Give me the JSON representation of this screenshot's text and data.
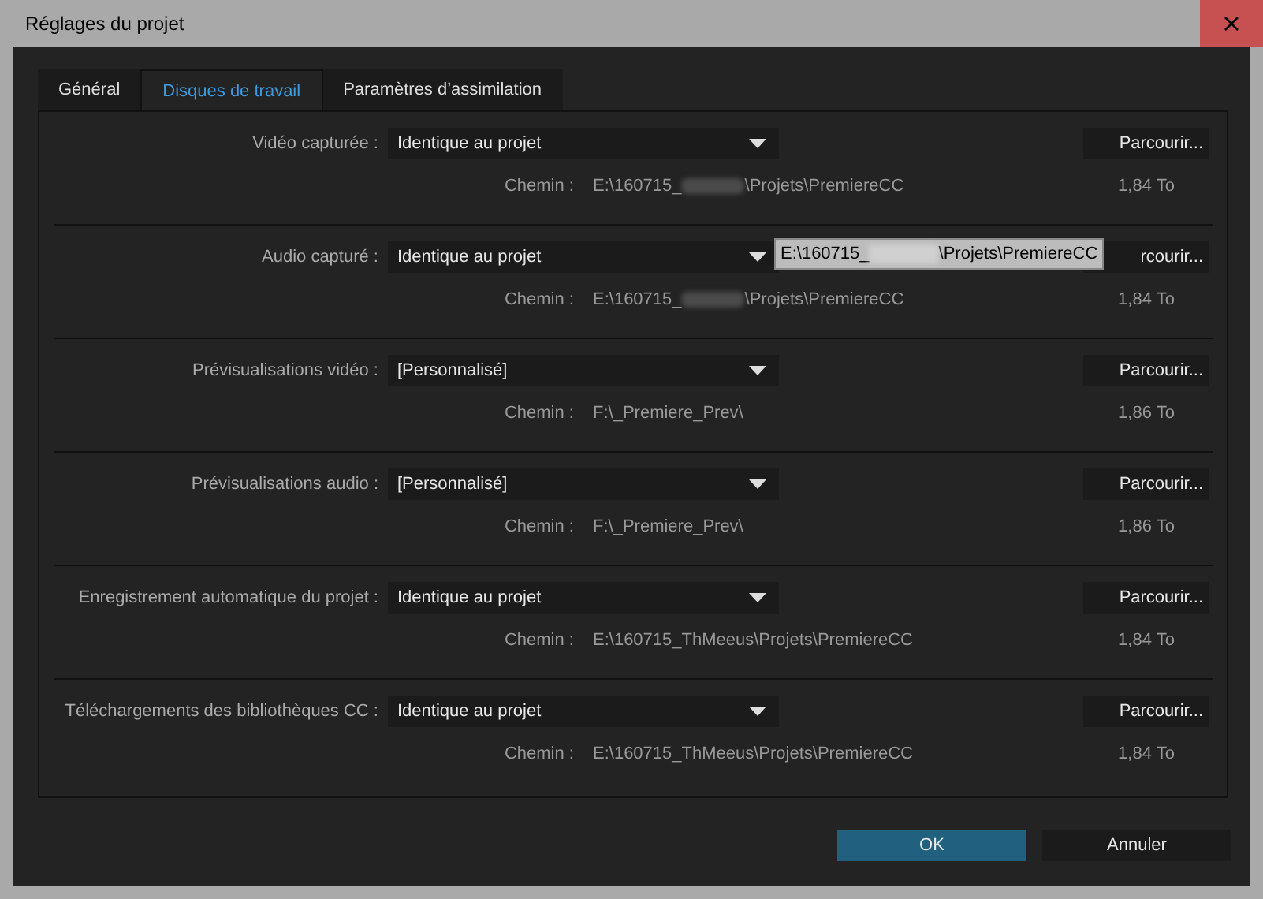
{
  "window": {
    "title": "Réglages du projet"
  },
  "tabs": [
    {
      "label": "Général",
      "selected": false
    },
    {
      "label": "Disques de travail",
      "selected": true
    },
    {
      "label": "Paramètres d’assimilation",
      "selected": false
    }
  ],
  "rows": [
    {
      "label": "Vidéo capturée :",
      "value": "Identique au projet",
      "button": "Parcourir...",
      "path_label": "Chemin :",
      "path_start": "E:\\160715_",
      "path_redacted": true,
      "path_end": "\\Projets\\PremiereCC",
      "size": "1,84 To"
    },
    {
      "label": "Audio capturé :",
      "value": "Identique au projet",
      "button": "rcourir...",
      "path_label": "Chemin :",
      "path_start": "E:\\160715_",
      "path_redacted": true,
      "path_end": "\\Projets\\PremiereCC",
      "size": "1,84 To",
      "tooltip": {
        "start": "E:\\160715_",
        "redacted": true,
        "end": "\\Projets\\PremiereCC"
      }
    },
    {
      "label": "Prévisualisations vidéo :",
      "value": "[Personnalisé]",
      "button": "Parcourir...",
      "path_label": "Chemin :",
      "path_start": "F:\\_Premiere_Prev\\",
      "size": "1,86 To"
    },
    {
      "label": "Prévisualisations audio :",
      "value": "[Personnalisé]",
      "button": "Parcourir...",
      "path_label": "Chemin :",
      "path_start": "F:\\_Premiere_Prev\\",
      "size": "1,86 To"
    },
    {
      "label": "Enregistrement automatique du projet :",
      "value": "Identique au projet",
      "button": "Parcourir...",
      "path_label": "Chemin :",
      "path_start": "E:\\160715_ThMeeus\\Projets\\PremiereCC",
      "size": "1,84 To"
    },
    {
      "label": "Téléchargements des bibliothèques CC :",
      "value": "Identique au projet",
      "button": "Parcourir...",
      "path_label": "Chemin :",
      "path_start": "E:\\160715_ThMeeus\\Projets\\PremiereCC",
      "size": "1,84 To"
    }
  ],
  "buttons": [
    {
      "label": "OK",
      "kind": "primary"
    },
    {
      "label": "Annuler",
      "kind": "secondary"
    }
  ]
}
